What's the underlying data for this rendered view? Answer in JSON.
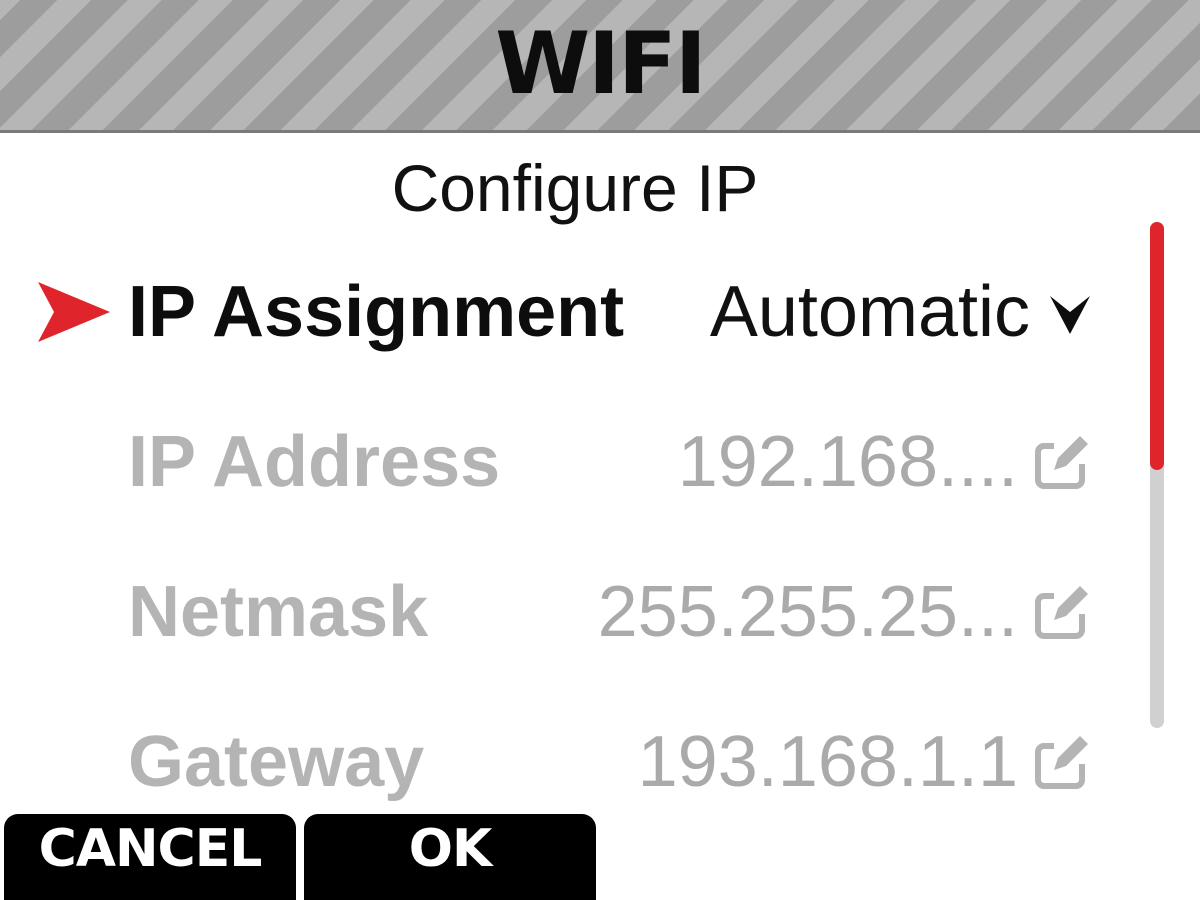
{
  "header": {
    "title": "WIFI"
  },
  "subtitle": "Configure IP",
  "rows": [
    {
      "label": "IP Assignment",
      "value": "Automatic",
      "state": "selected",
      "control": "chevron-down-icon"
    },
    {
      "label": "IP Address",
      "value": "192.168....",
      "state": "disabled",
      "control": "edit-icon"
    },
    {
      "label": "Netmask",
      "value": "255.255.25...",
      "state": "disabled",
      "control": "edit-icon"
    },
    {
      "label": "Gateway",
      "value": "193.168.1.1",
      "state": "disabled",
      "control": "edit-icon"
    }
  ],
  "softkeys": {
    "cancel": "CANCEL",
    "ok": "OK"
  },
  "colors": {
    "accent": "#e0242b",
    "text_active": "#0d0d0d",
    "text_disabled": "#b4b4b4",
    "softkey_bg": "#000000",
    "header_stripe_dark": "#9d9d9d",
    "header_stripe_light": "#b6b6b6"
  },
  "icons": {
    "selection_marker": "red-arrow-pointer-icon"
  },
  "scroll": {
    "position_fraction": 0.0,
    "visible_fraction": 0.49
  }
}
